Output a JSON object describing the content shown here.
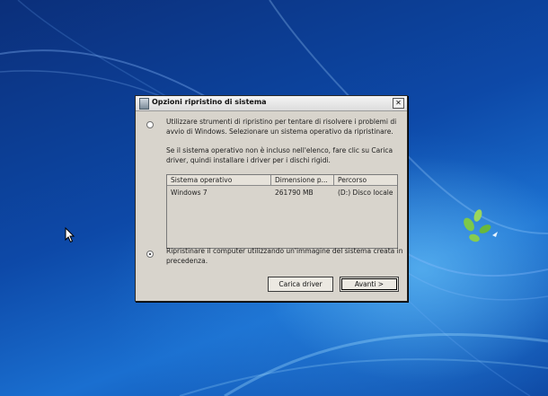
{
  "window": {
    "title": "Opzioni ripristino di sistema",
    "close_glyph": "✕"
  },
  "option1": {
    "selected": false,
    "text_line1": "Utilizzare strumenti di ripristino per tentare di risolvere i problemi di",
    "text_line2": "avvio di Windows. Selezionare un sistema operativo da ripristinare."
  },
  "info": {
    "line1": "Se il sistema operativo non è incluso nell'elenco, fare clic su Carica",
    "line2": "driver, quindi installare i driver per i dischi rigidi."
  },
  "table": {
    "columns": [
      "Sistema operativo",
      "Dimensione p...",
      "Percorso"
    ],
    "rows": [
      [
        "Windows 7",
        "261790 MB",
        "(D:) Disco locale"
      ]
    ]
  },
  "option2": {
    "selected": true,
    "text_line1": "Ripristinare il computer utilizzando un'immagine del sistema creata in",
    "text_line2": "precedenza."
  },
  "buttons": {
    "load_driver": "Carica driver",
    "next": "Avanti >"
  },
  "icons": [
    "app-icon",
    "close-icon",
    "mouse-pointer-icon"
  ]
}
